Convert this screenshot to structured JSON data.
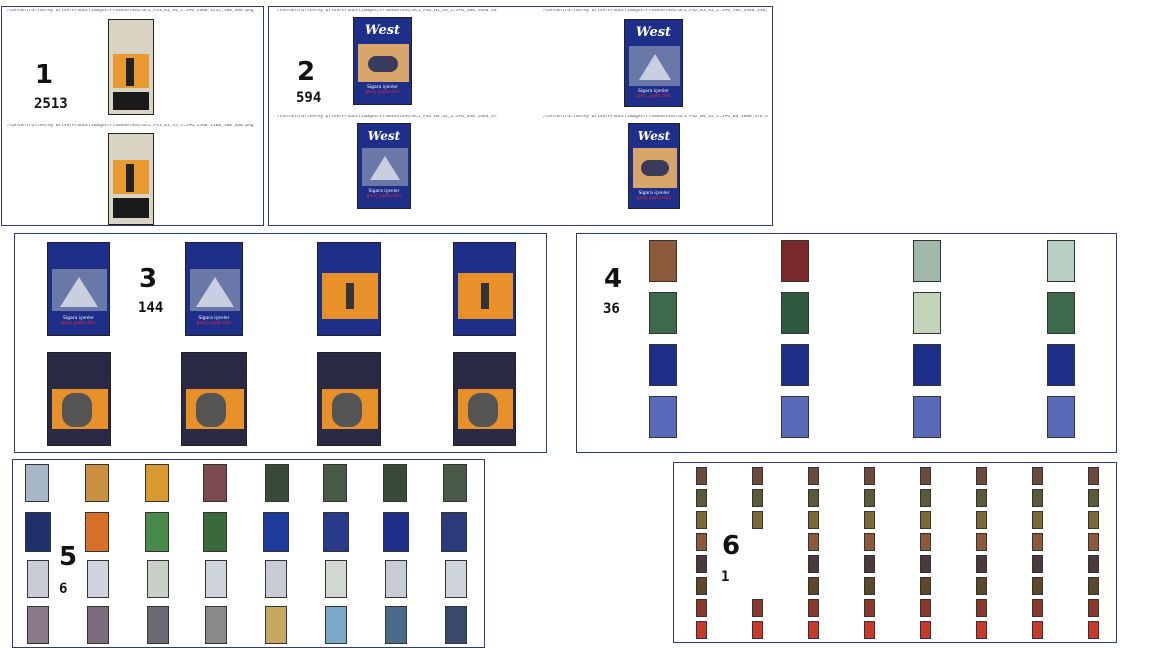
{
  "clusters": [
    {
      "id": "1",
      "count": "2513",
      "paths": [
        "/content/drive/My Drive/ProductImages/FromShelves/DC1_PS1_N1_S4_1.JPG_2968_1252_180_384.png",
        "/content/drive/My Drive/ProductImages/FromShelves/DC1_PS1_N1_S5_1.JPG_1588_1108_180_360.png"
      ]
    },
    {
      "id": "2",
      "count": "594",
      "paths": [
        "/content/drive/My Drive/ProductImages/FromShelves/DC1_PS2_N1_S3_1.JPG_108_1820_336_400.png",
        "/content/drive/My Drive/ProductImages/FromShelves/DC1_PS2_N1_S3_2.JPG_704_1936_336_408.png",
        "/content/drive/My Drive/ProductImages/FromShelves/DC1_PS2_N4_S2_1.JPG_440_1464_376_432.png",
        "/content/drive/My Drive/ProductImages/FromShelves/DC1_PS2_N4_S2_1.JPG_68_1800_376_432.png"
      ]
    },
    {
      "id": "3",
      "count": "144"
    },
    {
      "id": "4",
      "count": "36"
    },
    {
      "id": "5",
      "count": "6"
    },
    {
      "id": "6",
      "count": "1"
    }
  ],
  "pack_text": {
    "brand": "West",
    "warning_line": "Sigara içenler",
    "warning_red": "genç yaşta ölür"
  },
  "colors": {
    "panel_border": "#2c3e6e",
    "pack_blue": "#1e2f8a",
    "pack_orange": "#e8902a",
    "warning_red": "#e22233"
  }
}
